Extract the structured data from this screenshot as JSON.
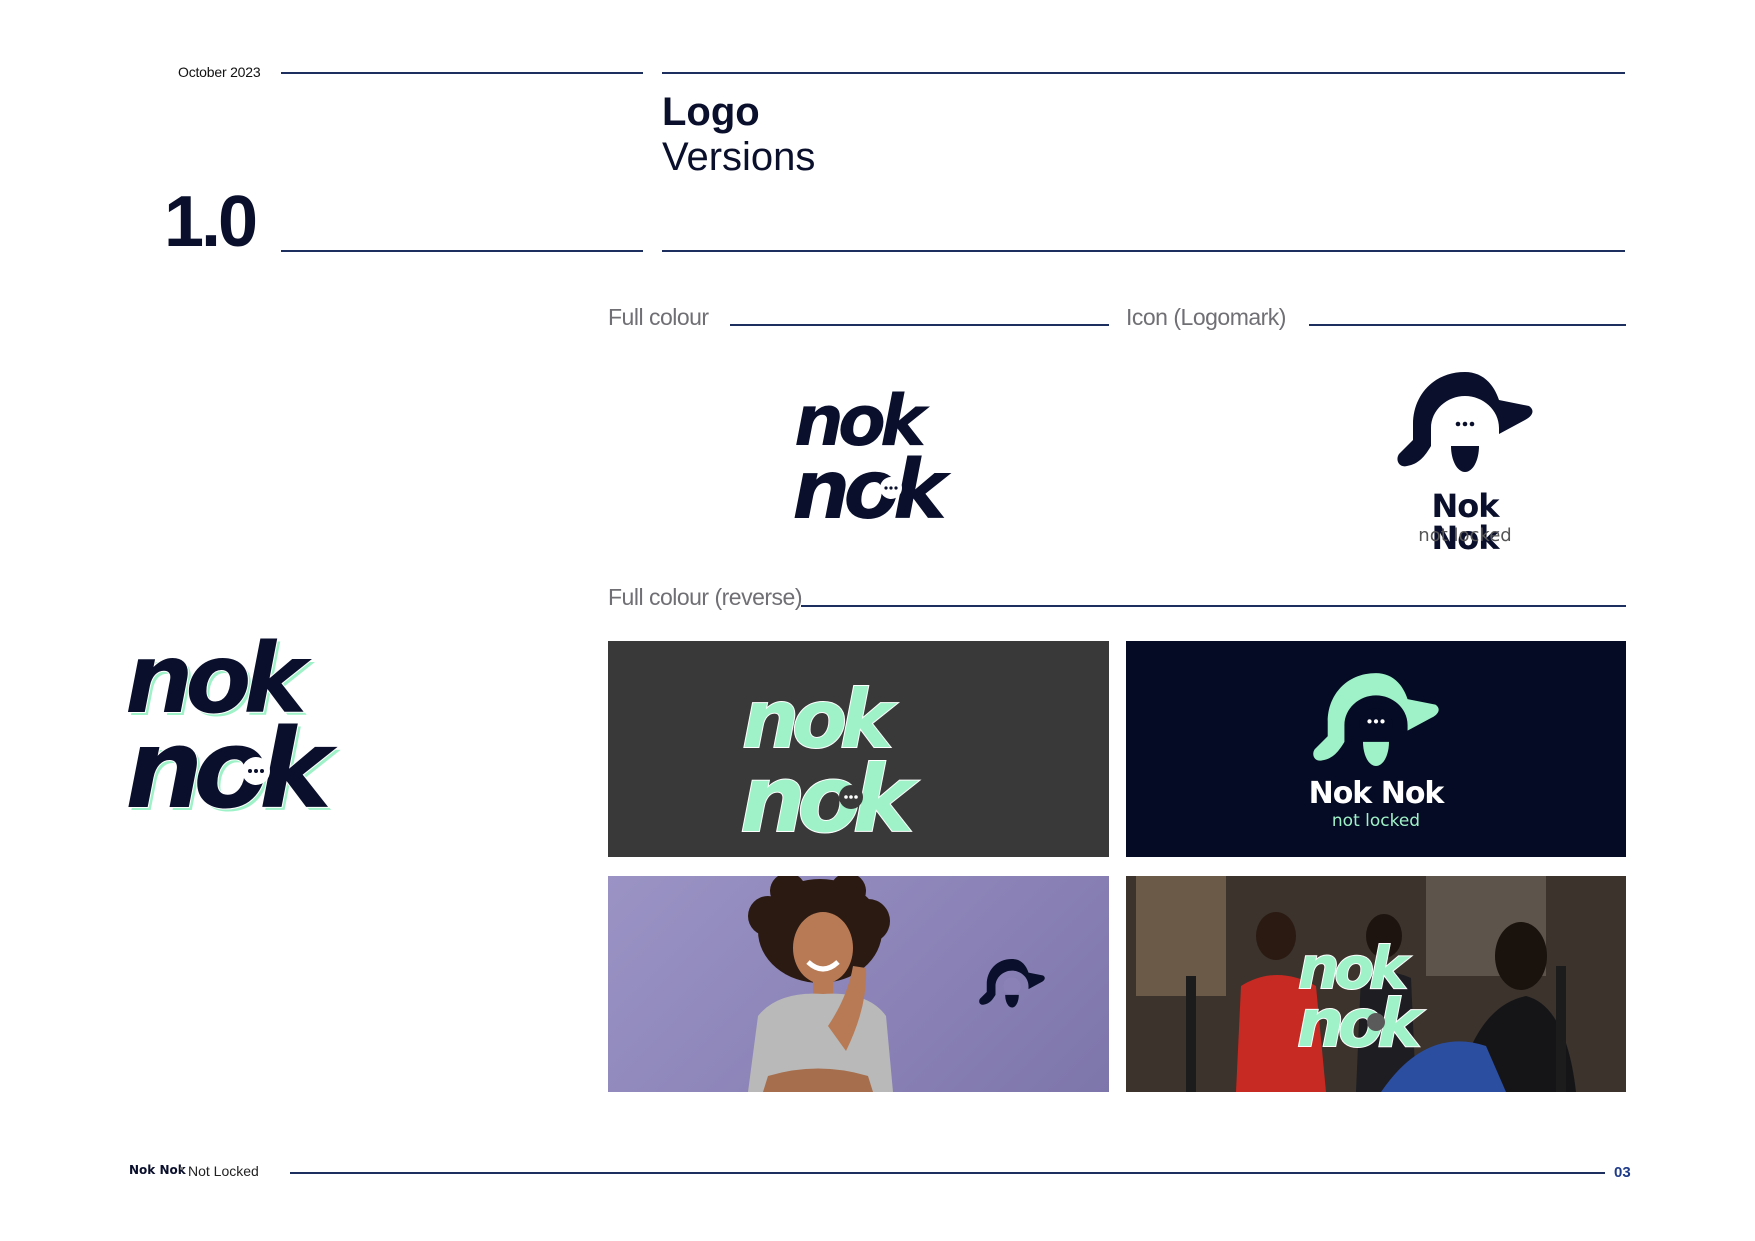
{
  "header": {
    "date": "October 2023",
    "section_number": "1.0",
    "title": "Logo",
    "subtitle": "Versions"
  },
  "labels": {
    "full_colour": "Full colour",
    "icon_logomark": "Icon (Logomark)",
    "full_colour_reverse": "Full colour (reverse)"
  },
  "logo": {
    "word_top": "nok",
    "word_bottom": "nok",
    "brand_name": "Nok Nok",
    "tagline": "not locked"
  },
  "footer": {
    "brand": "Nok Nok",
    "tagline": "Not Locked",
    "page_number": "03"
  },
  "colors": {
    "navy": "#0a0f2c",
    "mint": "#9ff2c8",
    "rule": "#1c2f5f",
    "label_grey": "#6f6f74",
    "panel_charcoal": "#393939",
    "panel_navy": "#050b24",
    "panel_lavender": "#8c84b8",
    "page_number_blue": "#1e3a8a"
  },
  "icons": [
    "speech-bubble-icon",
    "logomark-icon"
  ]
}
